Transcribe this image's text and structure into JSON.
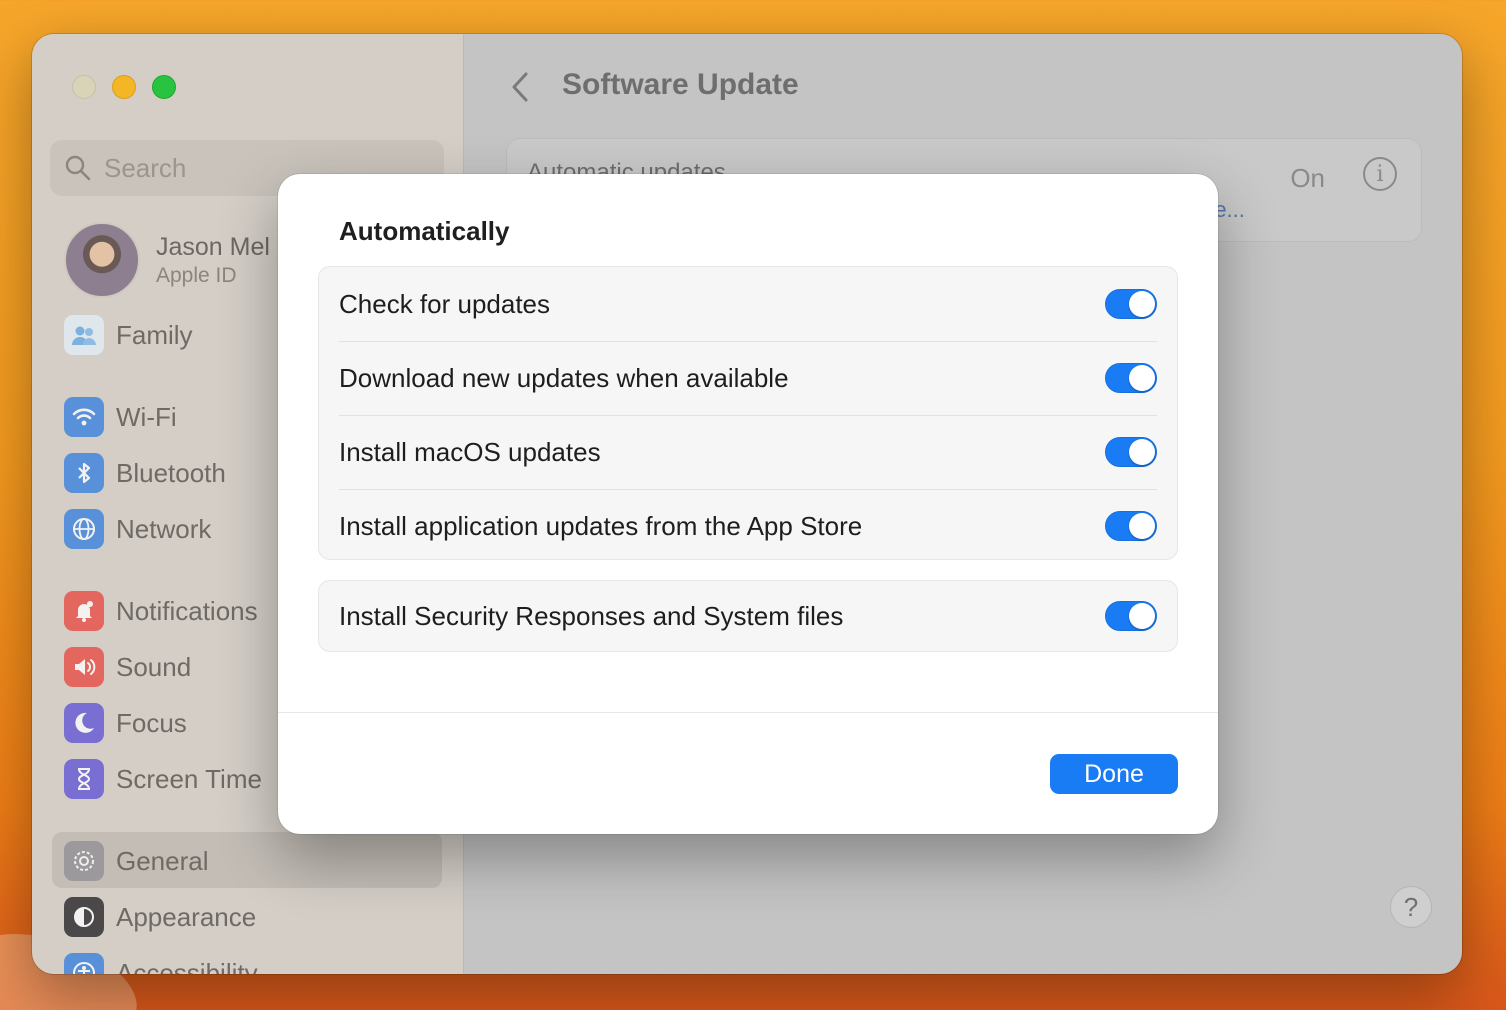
{
  "window": {
    "title": "Software Update"
  },
  "sidebar": {
    "search_placeholder": "Search",
    "profile": {
      "name": "Jason Mel",
      "subtitle": "Apple ID"
    },
    "items": [
      {
        "label": "Family",
        "icon": "family-icon",
        "color": "#5fa8e8"
      },
      {
        "label": "Wi-Fi",
        "icon": "wifi-icon",
        "color": "#2f7de1"
      },
      {
        "label": "Bluetooth",
        "icon": "bluetooth-icon",
        "color": "#2f7de1"
      },
      {
        "label": "Network",
        "icon": "globe-icon",
        "color": "#2f7de1"
      },
      {
        "label": "Notifications",
        "icon": "bell-icon",
        "color": "#e8453c"
      },
      {
        "label": "Sound",
        "icon": "speaker-icon",
        "color": "#e8453c"
      },
      {
        "label": "Focus",
        "icon": "moon-icon",
        "color": "#5b4fd6"
      },
      {
        "label": "Screen Time",
        "icon": "hourglass-icon",
        "color": "#5b4fd6"
      },
      {
        "label": "General",
        "icon": "gear-icon",
        "color": "#8e8e93",
        "selected": true
      },
      {
        "label": "Appearance",
        "icon": "appearance-icon",
        "color": "#1c1c1e"
      },
      {
        "label": "Accessibility",
        "icon": "accessibility-icon",
        "color": "#2f7de1"
      }
    ]
  },
  "main": {
    "card": {
      "title": "Automatic updates",
      "link": "re...",
      "status": "On"
    }
  },
  "modal": {
    "heading": "Automatically",
    "group1": [
      {
        "label": "Check for updates",
        "on": true
      },
      {
        "label": "Download new updates when available",
        "on": true
      },
      {
        "label": "Install macOS updates",
        "on": true
      },
      {
        "label": "Install application updates from the App Store",
        "on": true
      }
    ],
    "group2": [
      {
        "label": "Install Security Responses and System files",
        "on": true
      }
    ],
    "done_label": "Done"
  },
  "colors": {
    "accent": "#1a7cf5",
    "traffic_close": "#d9d3b8",
    "traffic_minimize": "#f4b625",
    "traffic_maximize": "#29c43f"
  }
}
